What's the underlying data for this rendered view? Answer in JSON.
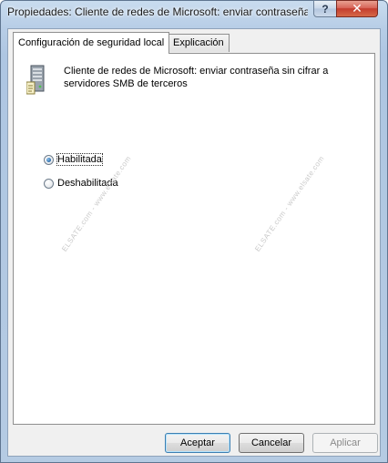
{
  "window": {
    "title": "Propiedades: Cliente de redes de Microsoft: enviar contraseña...",
    "help_label": "?",
    "close_label": "✕"
  },
  "tabs": [
    {
      "label": "Configuración de seguridad local",
      "active": true
    },
    {
      "label": "Explicación",
      "active": false
    }
  ],
  "policy": {
    "icon": "server-policy-icon",
    "name": "Cliente de redes de Microsoft: enviar contraseña sin cifrar a servidores SMB de terceros"
  },
  "options": [
    {
      "label": "Habilitada",
      "selected": true
    },
    {
      "label": "Deshabilitada",
      "selected": false
    }
  ],
  "watermark": "ELSATE.com - www.elsate.com",
  "buttons": {
    "ok": "Aceptar",
    "cancel": "Cancelar",
    "apply": "Aplicar"
  }
}
